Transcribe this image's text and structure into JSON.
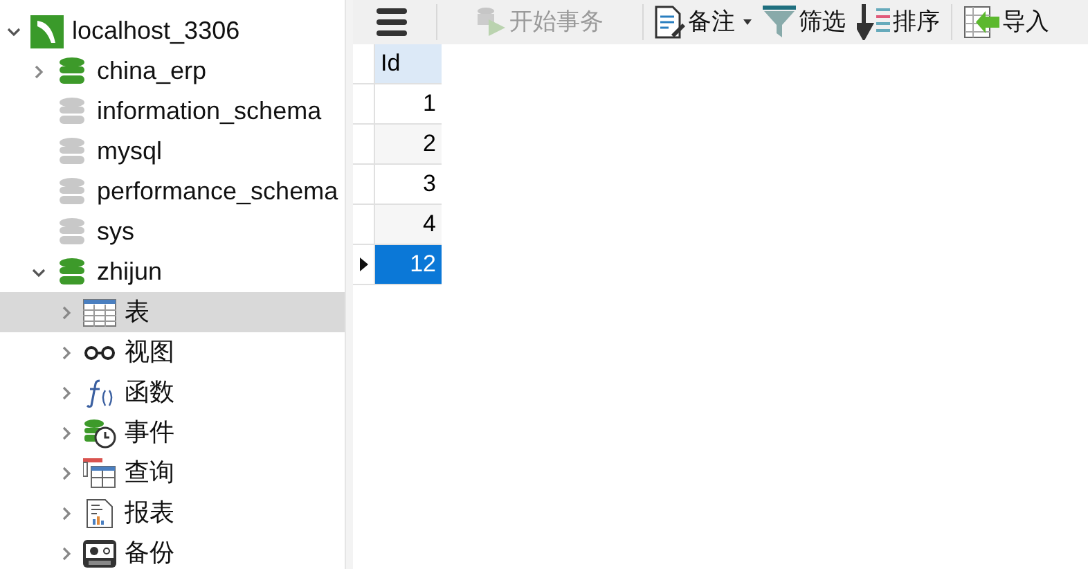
{
  "tree": [
    {
      "kind": "connection",
      "label": "localhost_3306",
      "expanded": true,
      "selected": false,
      "children": [
        {
          "kind": "database",
          "label": "china_erp",
          "open": true,
          "expandable": true,
          "expanded": false,
          "selected": false
        },
        {
          "kind": "database",
          "label": "information_schema",
          "open": false,
          "expandable": false,
          "selected": false
        },
        {
          "kind": "database",
          "label": "mysql",
          "open": false,
          "expandable": false,
          "selected": false
        },
        {
          "kind": "database",
          "label": "performance_schema",
          "open": false,
          "expandable": false,
          "selected": false
        },
        {
          "kind": "database",
          "label": "sys",
          "open": false,
          "expandable": false,
          "selected": false
        },
        {
          "kind": "database",
          "label": "zhijun",
          "open": true,
          "expandable": true,
          "expanded": true,
          "selected": false,
          "children": [
            {
              "kind": "tables",
              "label": "表",
              "expandable": true,
              "expanded": false,
              "selected": true
            },
            {
              "kind": "views",
              "label": "视图",
              "expandable": true,
              "expanded": false,
              "selected": false
            },
            {
              "kind": "functions",
              "label": "函数",
              "expandable": true,
              "expanded": false,
              "selected": false
            },
            {
              "kind": "events",
              "label": "事件",
              "expandable": true,
              "expanded": false,
              "selected": false
            },
            {
              "kind": "queries",
              "label": "查询",
              "expandable": true,
              "expanded": false,
              "selected": false
            },
            {
              "kind": "reports",
              "label": "报表",
              "expandable": true,
              "expanded": false,
              "selected": false
            },
            {
              "kind": "backups",
              "label": "备份",
              "expandable": true,
              "expanded": false,
              "selected": false
            }
          ]
        }
      ]
    }
  ],
  "toolbar": [
    {
      "kind": "menu"
    },
    {
      "kind": "transaction",
      "label": "开始事务",
      "disabled": true
    },
    {
      "kind": "note",
      "label": "备注",
      "disabled": false
    },
    {
      "kind": "filter",
      "label": "筛选",
      "disabled": false
    },
    {
      "kind": "sort",
      "label": "排序",
      "disabled": false
    },
    {
      "kind": "import",
      "label": "导入",
      "disabled": false
    }
  ],
  "table": {
    "columns": [
      "Id"
    ],
    "rows": [
      {
        "cells": [
          "1"
        ],
        "selected": false
      },
      {
        "cells": [
          "2"
        ],
        "selected": false
      },
      {
        "cells": [
          "3"
        ],
        "selected": false
      },
      {
        "cells": [
          "4"
        ],
        "selected": false
      },
      {
        "cells": [
          "12"
        ],
        "selected": true
      }
    ]
  }
}
